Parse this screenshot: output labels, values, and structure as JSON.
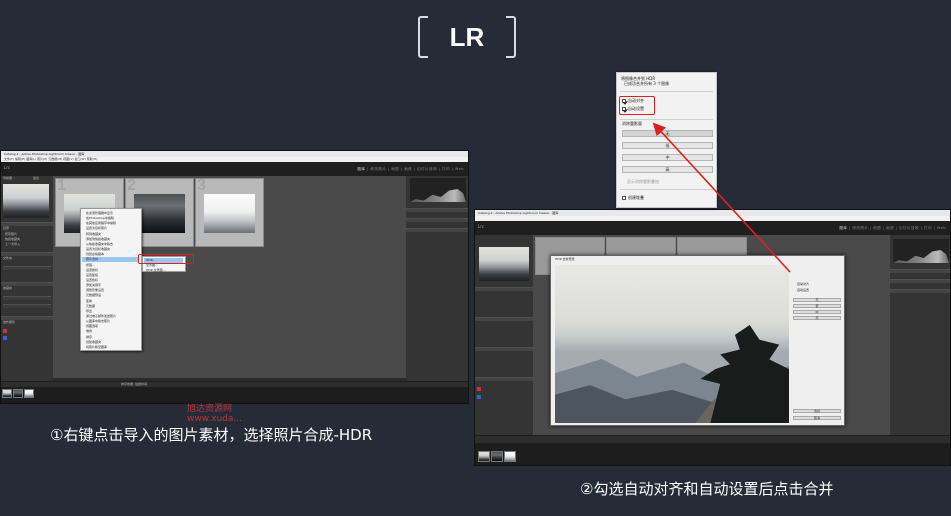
{
  "slide": {
    "title": "LR",
    "caption_1": "①右键点击导入的图片素材，选择照片合成-HDR",
    "caption_2": "②勾选自动对齐和自动设置后点击合并",
    "watermark_line1": "旭达资源网",
    "watermark_line2": "www.xuda...",
    "annotation_color": "#e02020"
  },
  "left_window": {
    "title": "Catalog-2 - Adobe Photoshop Lightroom Classic - 图库",
    "menubar": "文件(F)  编辑(E)  图库(L)  照片(P)  元数据(M)  视图(V)  窗口(W)  帮助(H)",
    "logo": "Lrc",
    "modules": [
      "图库",
      "修改照片",
      "地图",
      "画册",
      "幻灯片放映",
      "打印",
      "Web"
    ],
    "active_module": "图库",
    "left_panel_items": [
      "导航器",
      "适合",
      "目录",
      "所有照片",
      "快捷收藏夹",
      "上一次导入",
      "文件夹",
      "收藏夹",
      "发布服务"
    ],
    "thumbnails": [
      "1",
      "2",
      "3"
    ],
    "context_menu": [
      "在资源管理器中显示",
      "在Photoshop中编辑",
      "在其他应用程序中编辑",
      "设置为目标照片",
      "转到收藏夹",
      "添加到快捷收藏夹",
      "从快捷收藏夹中移去",
      "设置为目标收藏夹",
      "创建虚拟副本",
      "照片合并",
      "增强...",
      "设置旗标",
      "设置星级",
      "设置色标",
      "添加关键字",
      "调整影像设置",
      "元数据预设",
      "变换",
      "元数据",
      "导出",
      "通过电子邮件发送照片",
      "从图库中移去照片",
      "视图选项",
      "堆叠",
      "排序",
      "创建收藏夹",
      "将照片移至图库"
    ],
    "highlighted_index": 9,
    "submenu": [
      "HDR...",
      "全景图...",
      "HDR 全景图..."
    ],
    "submenu_highlight": 0,
    "toolbar_label": "排序依据: 拍摄时间"
  },
  "right_window": {
    "title": "Catalog-2 - Adobe Photoshop Lightroom Classic - 图库",
    "logo": "Lrc",
    "modules": [
      "图库",
      "修改照片",
      "地图",
      "画册",
      "幻灯片放映",
      "打印",
      "Web"
    ],
    "dialog_title": "HDR 合并预览",
    "dialog_buttons": [
      "合并",
      "取消"
    ],
    "dialog_options": [
      "自动对齐",
      "自动设置"
    ],
    "deghost_options": [
      "无",
      "低",
      "中",
      "高"
    ]
  },
  "hdr_panel": {
    "heading": "将图像合并到 HDR",
    "subheading": "已成功合并所有 3 个图像",
    "options": [
      {
        "label": "自动对齐",
        "checked": true
      },
      {
        "label": "自动设置",
        "checked": true
      }
    ],
    "deghost_heading": "消除重影量",
    "deghost_options": [
      "无",
      "低",
      "中",
      "高"
    ],
    "deghost_selected": 0,
    "show_overlay": "显示消除重影叠加",
    "create_stack": "创建堆叠",
    "create_stack_checked": false
  }
}
